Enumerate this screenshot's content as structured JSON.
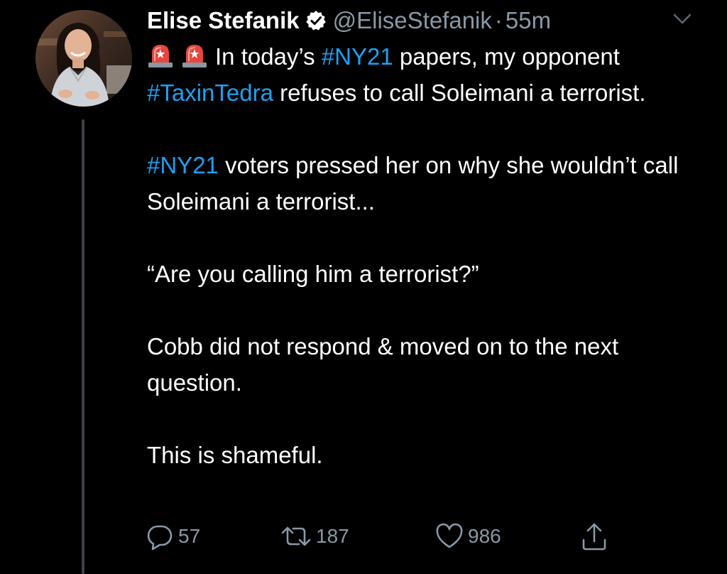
{
  "tweet": {
    "author_name": "Elise Stefanik",
    "handle": "@EliseStefanik",
    "separator": "·",
    "time": "55m",
    "body": {
      "line1_text_a": "In today’s ",
      "hashtag_ny21_a": "#NY21",
      "line1_text_b": " papers, my opponent ",
      "hashtag_taxintedra": "#TaxinTedra",
      "line1_text_c": " refuses to call Soleimani a terrorist.",
      "hashtag_ny21_b": "#NY21",
      "para2_text": " voters pressed her on why she wouldn’t call Soleimani a terrorist...",
      "para3_text": "“Are you calling him a terrorist?”",
      "para4_text": "Cobb did not respond & moved on to the next question.",
      "para5_text": "This is shameful."
    },
    "counts": {
      "replies": "57",
      "retweets": "187",
      "likes": "986"
    }
  },
  "icons": {
    "verified": "verified-badge-icon",
    "caret": "chevron-down-icon",
    "siren": "rotating-light-emoji",
    "reply": "reply-icon",
    "retweet": "retweet-icon",
    "like": "heart-icon",
    "share": "share-icon"
  },
  "colors": {
    "background": "#000000",
    "text": "#ffffff",
    "muted": "#8899a6",
    "hashtag": "#1da1f2",
    "thread_line": "#3d4348"
  }
}
